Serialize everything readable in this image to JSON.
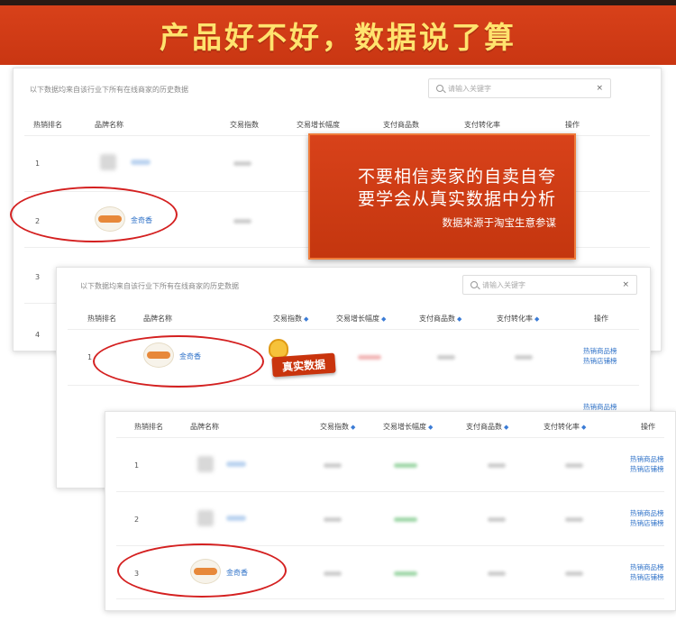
{
  "banner": {
    "title": "产品好不好，数据说了算"
  },
  "table_note": "以下数据均来自该行业下所有在线商家的历史数据",
  "search": {
    "placeholder": "请输入关键字",
    "clear": "×"
  },
  "columns": [
    "热销排名",
    "品牌名称",
    "交易指数",
    "交易增长幅度",
    "支付商品数",
    "支付转化率",
    "操作"
  ],
  "brand": "金奇香",
  "ops": [
    "热销商品榜",
    "热销店铺榜"
  ],
  "panel1": {
    "ranks": [
      "1",
      "2",
      "3",
      "4"
    ]
  },
  "panel2": {
    "ranks": [
      "1"
    ]
  },
  "panel3": {
    "ranks": [
      "1",
      "2",
      "3"
    ]
  },
  "callout": {
    "line1": "不要相信卖家的自卖自夸",
    "line2": "要学会从真实数据中分析",
    "line3": "数据来源于淘宝生意参谋"
  },
  "stamp": {
    "label": "真实数据"
  },
  "colors": {
    "banner": "#c93612",
    "banner_text": "#ffe36e",
    "link": "#2f72c8",
    "highlight": "#d42020"
  }
}
